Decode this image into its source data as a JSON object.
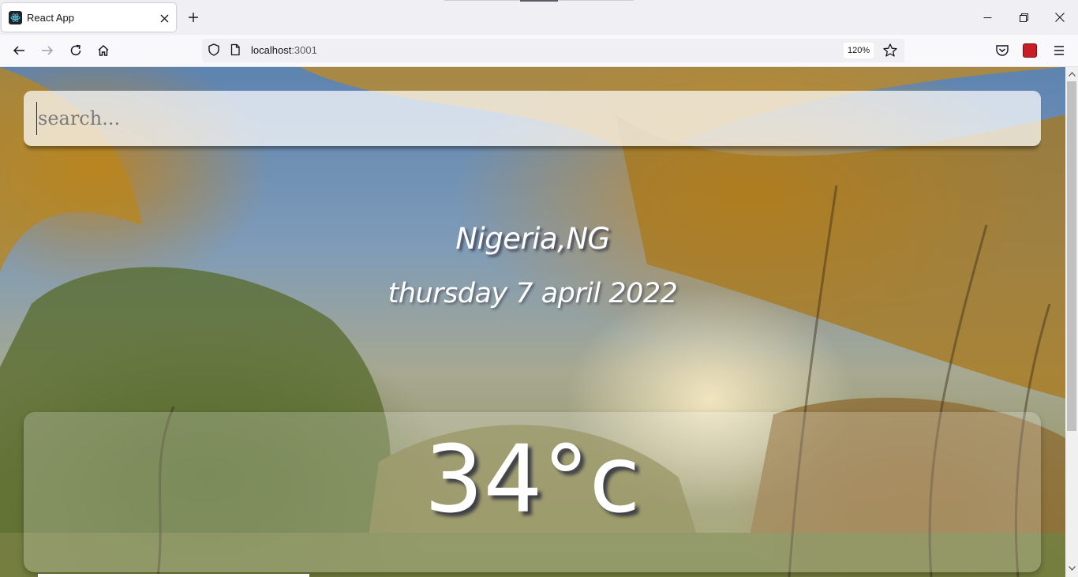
{
  "browser": {
    "tab": {
      "title": "React App",
      "favicon": "react-atom-icon"
    },
    "new_tab_icon": "plus-icon",
    "window_controls": [
      "minimize-icon",
      "restore-icon",
      "close-icon"
    ],
    "nav": {
      "back_icon": "back-arrow-icon",
      "forward_icon": "forward-arrow-icon",
      "reload_icon": "reload-icon",
      "home_icon": "home-icon"
    },
    "url": {
      "host": "localhost",
      "port": ":3001"
    },
    "zoom": "120%",
    "toolbar_icons": [
      "pocket-icon",
      "extension-icon",
      "menu-icon"
    ]
  },
  "page": {
    "search": {
      "placeholder": "search...",
      "value": ""
    },
    "location": "Nigeria,NG",
    "date": "thursday 7 april 2022",
    "temperature": "34°c"
  },
  "colors": {
    "chrome_bg": "#f0f0f4",
    "text": "#15141a",
    "scroll_thumb": "#c1c1c1"
  }
}
